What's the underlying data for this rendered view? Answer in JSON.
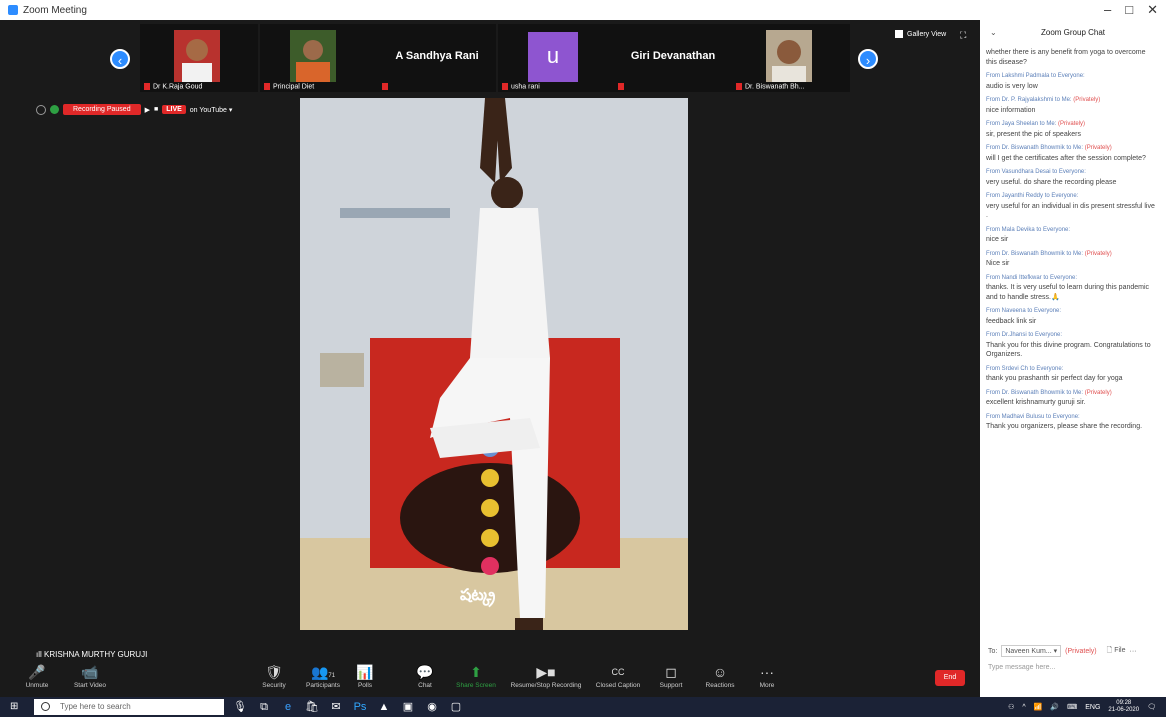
{
  "window": {
    "title": "Zoom Meeting",
    "controls": [
      "–",
      "□",
      "✕"
    ]
  },
  "gallery": {
    "tiles": [
      {
        "name": "Dr K.Raja Goud",
        "type": "photo"
      },
      {
        "name": "Principal Diet",
        "type": "photo"
      },
      {
        "name": "",
        "display": "A Sandhya Rani",
        "type": "text"
      },
      {
        "name": "usha rani",
        "display": "u",
        "type": "avatar"
      },
      {
        "name": "",
        "display": "Giri Devanathan",
        "type": "text"
      },
      {
        "name": "Dr. Biswanath Bh...",
        "type": "photo"
      }
    ],
    "view_label": "Gallery View"
  },
  "recording": {
    "status": "Recording Paused",
    "live": "LIVE",
    "platform": "on YouTube ▾"
  },
  "active_speaker": "KRISHNA MURTHY GURUJI",
  "video": {
    "poster_text": "షట్క్ర"
  },
  "toolbar": {
    "items": [
      {
        "label": "Unmute",
        "icon": "🎤"
      },
      {
        "label": "Start Video",
        "icon": "📹"
      },
      {
        "label": "Security",
        "icon": "🛡"
      },
      {
        "label": "Participants",
        "icon": "👥",
        "count": "71"
      },
      {
        "label": "Polls",
        "icon": "📊"
      },
      {
        "label": "Chat",
        "icon": "💬"
      },
      {
        "label": "Share Screen",
        "icon": "⬆"
      },
      {
        "label": "Resume/Stop Recording",
        "icon": "▶■"
      },
      {
        "label": "Closed Caption",
        "icon": "CC"
      },
      {
        "label": "Support",
        "icon": "◻"
      },
      {
        "label": "Reactions",
        "icon": "☺"
      },
      {
        "label": "More",
        "icon": "···"
      }
    ],
    "end": "End"
  },
  "chat": {
    "title": "Zoom Group Chat",
    "messages": [
      {
        "from": "",
        "text": "whether there is any benefit from yoga to overcome this disease?"
      },
      {
        "from": "From Lakshmi Padmala to Everyone:",
        "private": "",
        "text": "audio is very low"
      },
      {
        "from": "From Dr. P. Rajyalakshmi to Me:",
        "private": "(Privately)",
        "text": "nice information"
      },
      {
        "from": "From Jaya Sheelan to Me:",
        "private": "(Privately)",
        "text": "sir, present the pic  of speakers"
      },
      {
        "from": "From Dr. Biswanath Bhowmik to Me:",
        "private": "(Privately)",
        "text": "will I get the certificates after the session complete?"
      },
      {
        "from": "From Vasundhara Desai to Everyone:",
        "private": "",
        "text": "very useful.  do share the recording please"
      },
      {
        "from": "From Jayanthi Reddy to Everyone:",
        "private": "",
        "text": "very useful for an individual in dis present stressful live ."
      },
      {
        "from": "From Mala Devika to Everyone:",
        "private": "",
        "text": "nice sir"
      },
      {
        "from": "From Dr. Biswanath Bhowmik to Me:",
        "private": "(Privately)",
        "text": "Nice sir"
      },
      {
        "from": "From Nandi Ittefkwar to Everyone:",
        "private": "",
        "text": "thanks. It is very useful to learn during this pandemic and to handle stress.🙏"
      },
      {
        "from": "From Naveena to Everyone:",
        "private": "",
        "text": "feedback link sir"
      },
      {
        "from": "From Dr.Jhansi to Everyone:",
        "private": "",
        "text": "Thank you for this divine program. Congratulations to Organizers."
      },
      {
        "from": "From Srdevi Ch to Everyone:",
        "private": "",
        "text": "thank you prashanth sir perfect day for yoga"
      },
      {
        "from": "From Dr. Biswanath Bhowmik to Me:",
        "private": "(Privately)",
        "text": "excellent krishnamurty guruji sir."
      },
      {
        "from": "From Madhavi Bulusu to Everyone:",
        "private": "",
        "text": "Thank you organizers, please share the recording."
      }
    ],
    "to_label": "To:",
    "to_value": "Naveen Kum... ▾",
    "to_private": "(Privately)",
    "file": "File",
    "placeholder": "Type message here..."
  },
  "taskbar": {
    "search_placeholder": "Type here to search",
    "language": "ENG",
    "time": "09:28",
    "date": "21-06-2020"
  },
  "colors": {
    "accent": "#2d8cff",
    "record": "#e02828",
    "avatar": "#8e55d0"
  }
}
